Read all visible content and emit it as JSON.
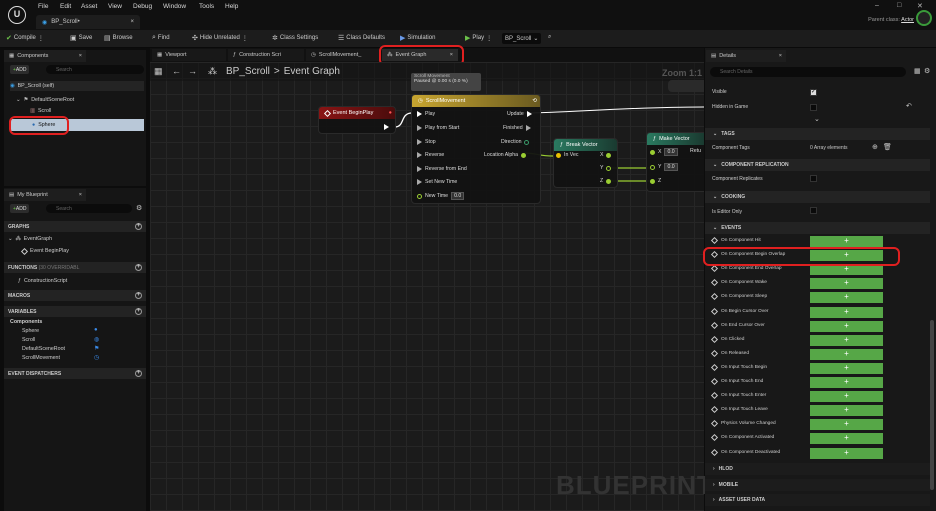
{
  "menu": [
    "File",
    "Edit",
    "Asset",
    "View",
    "Debug",
    "Window",
    "Tools",
    "Help"
  ],
  "doc_tab": "BP_Scroll•",
  "parent_class": {
    "label": "Parent class:",
    "value": "Actor"
  },
  "toolbar": {
    "compile": "Compile",
    "save": "Save",
    "browse": "Browse",
    "find": "Find",
    "hide_unrelated": "Hide Unrelated",
    "class_settings": "Class Settings",
    "class_defaults": "Class Defaults",
    "simulation": "Simulation",
    "play": "Play",
    "debug_target": "BP_Scroll"
  },
  "components": {
    "tab": "Components",
    "add": "ADD",
    "search_placeholder": "Search",
    "root": "BP_Scroll (self)",
    "items": [
      "DefaultSceneRoot",
      "Scroll",
      "Sphere"
    ]
  },
  "my_blueprint": {
    "tab": "My Blueprint",
    "add": "ADD",
    "search_placeholder": "Search",
    "graphs_label": "GRAPHS",
    "event_graph": "EventGraph",
    "event_beginplay": "Event BeginPlay",
    "functions_label": "FUNCTIONS",
    "functions_count": "(30 OVERRIDABL",
    "construction_script": "ConstructionScript",
    "macros_label": "MACROS",
    "variables_label": "VARIABLES",
    "components_label": "Components",
    "variables": [
      "Sphere",
      "Scroll",
      "DefaultSceneRoot",
      "ScrollMovement"
    ],
    "event_dispatchers_label": "EVENT DISPATCHERS"
  },
  "editor_tabs": [
    "Viewport",
    "Construction Scri",
    "ScrollMovement_",
    "Event Graph"
  ],
  "breadcrumb": {
    "bp": "BP_Scroll",
    "sep": ">",
    "graph": "Event Graph"
  },
  "zoom": "Zoom 1:1",
  "watermark": "BLUEPRINT",
  "nodes": {
    "begin_play": "Event BeginPlay",
    "timeline": {
      "title": "ScrollMovement",
      "tooltip_title": "Scroll Movement",
      "tooltip_value": "Paused @ 0.00 s (0.0 %)",
      "inputs": [
        "Play",
        "Play from Start",
        "Stop",
        "Reverse",
        "Reverse from End",
        "Set New Time",
        "New Time"
      ],
      "new_time_value": "0.0",
      "outputs": [
        "Update",
        "Finished",
        "Direction",
        "Location Alpha"
      ]
    },
    "break_vector": {
      "title": "Break Vector",
      "input": "In Vec",
      "outputs": [
        "X",
        "Y",
        "Z"
      ]
    },
    "make_vector": {
      "title": "Make Vector",
      "inputs": [
        "X",
        "Y",
        "Z"
      ],
      "x_value": "0.0",
      "y_value": "0.0",
      "output": "Retu"
    }
  },
  "details": {
    "tab": "Details",
    "search_placeholder": "Search Details",
    "visible_label": "Visible",
    "hidden_label": "Hidden in Game",
    "tags_label": "TAGS",
    "component_tags_label": "Component Tags",
    "component_tags_value": "0 Array elements",
    "replication_label": "COMPONENT REPLICATION",
    "replicates_label": "Component Replicates",
    "cooking_label": "COOKING",
    "editor_only_label": "Is Editor Only",
    "events_label": "EVENTS",
    "events": [
      "On Component Hit",
      "On Component Begin Overlap",
      "On Component End Overlap",
      "On Component Wake",
      "On Component Sleep",
      "On Begin Cursor Over",
      "On End Cursor Over",
      "On Clicked",
      "On Released",
      "On Input Touch Begin",
      "On Input Touch End",
      "On Input Touch Enter",
      "On Input Touch Leave",
      "Physics Volume Changed",
      "On Component Activated",
      "On Component Deactivated"
    ],
    "add_symbol": "+",
    "hlod_label": "HLOD",
    "mobile_label": "MOBILE",
    "asset_user_data_label": "ASSET USER DATA"
  },
  "colors": {
    "highlight": "#e02020",
    "event_button": "#56a747",
    "accent": "#3aa0e8"
  }
}
